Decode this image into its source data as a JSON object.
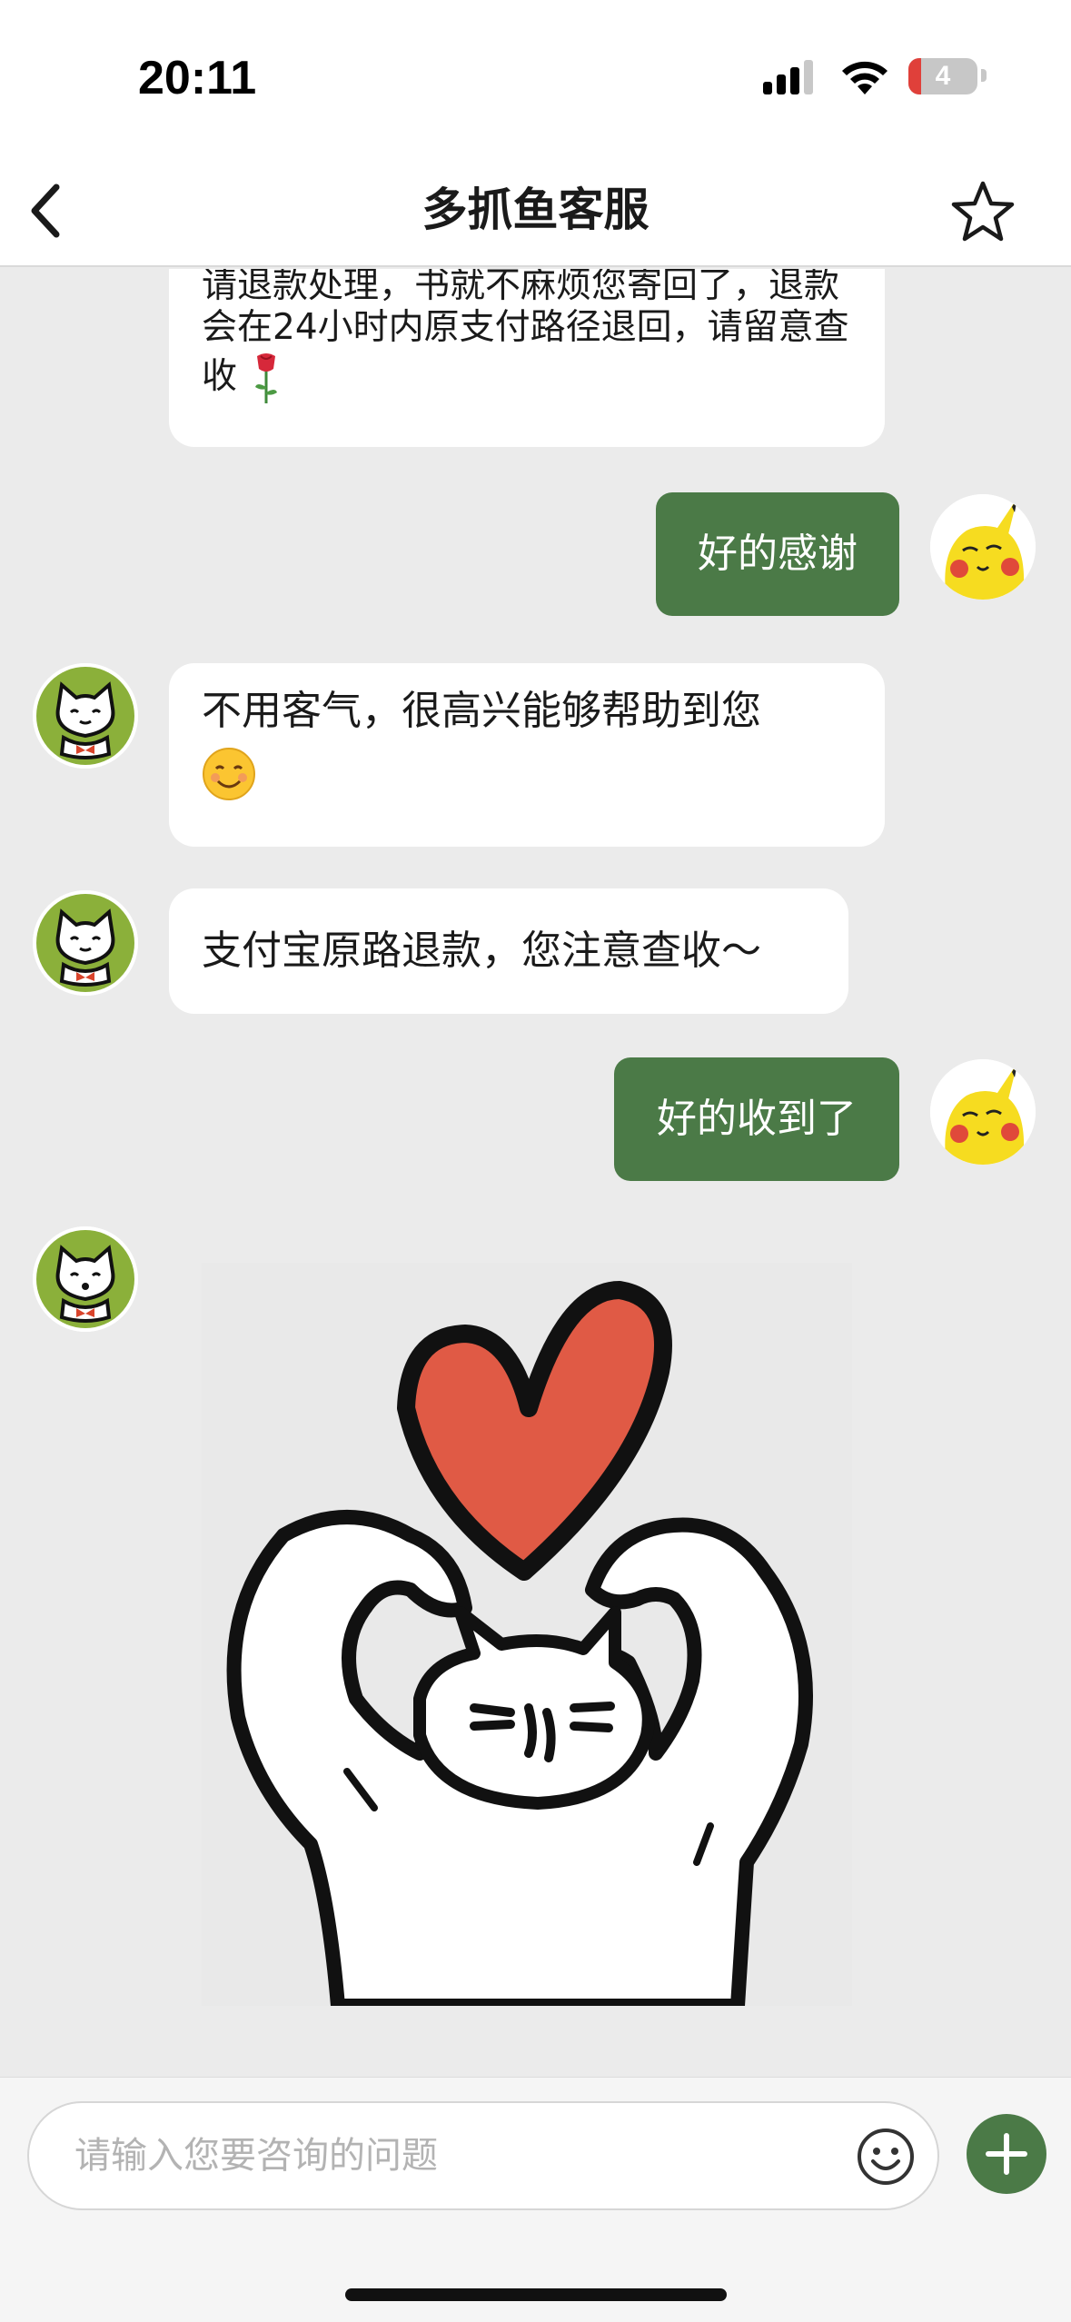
{
  "status_bar": {
    "time": "20:11",
    "battery_level": "4",
    "battery_color": "#e0403a"
  },
  "nav": {
    "title": "多抓鱼客服",
    "back_icon": "chevron-left-icon",
    "star_icon": "star-outline-icon"
  },
  "messages": [
    {
      "sender": "agent",
      "text_lines": [
        "请退款处理，书就不麻烦您寄回了，退款",
        "会在24小时内原支付路径退回，请留意查",
        "收"
      ],
      "emoji": "rose-emoji"
    },
    {
      "sender": "user",
      "text": "好的感谢"
    },
    {
      "sender": "agent",
      "text": "不用客气，很高兴能够帮助到您",
      "emoji": "smiling-face-emoji"
    },
    {
      "sender": "agent",
      "text": "支付宝原路退款，您注意查收～"
    },
    {
      "sender": "user",
      "text": "好的收到了"
    },
    {
      "sender": "agent",
      "sticker": "cat-heart-sticker"
    }
  ],
  "input": {
    "placeholder": "请输入您要咨询的问题",
    "emoji_icon": "smiley-icon",
    "plus_icon": "plus-icon"
  },
  "colors": {
    "user_bubble": "#4b7a47",
    "agent_bubble": "#ffffff",
    "background": "#ebebeb",
    "accent": "#4b7a47"
  }
}
